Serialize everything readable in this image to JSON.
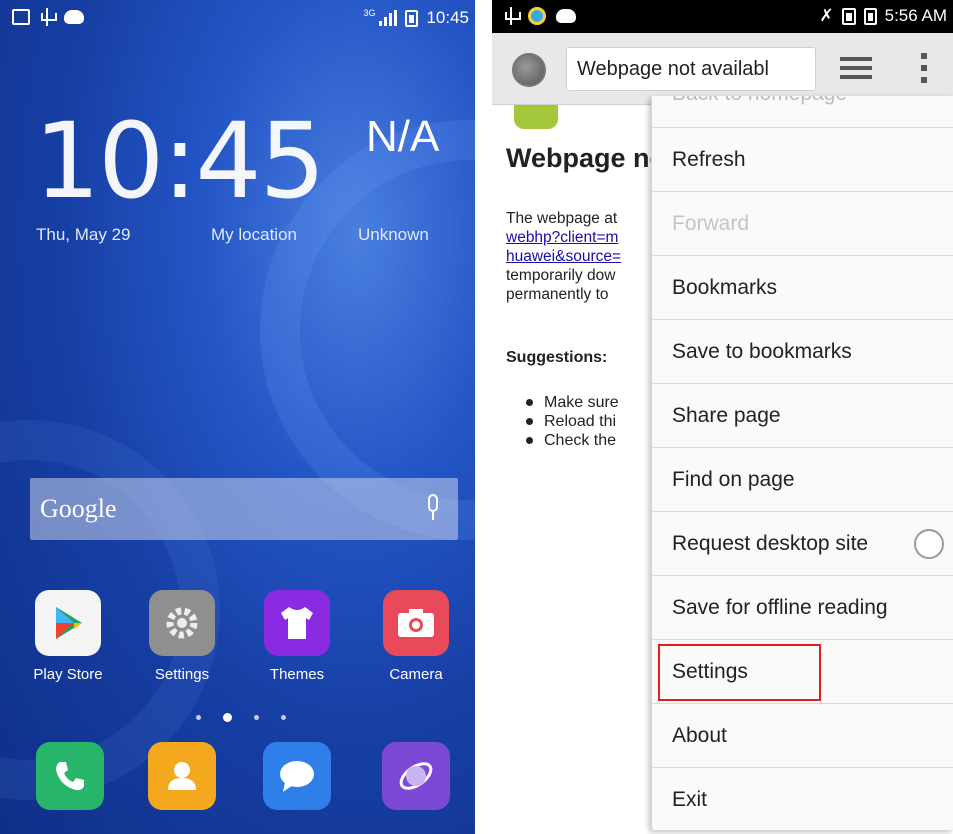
{
  "left_phone": {
    "status_bar": {
      "network_label": "3G",
      "time": "10:45"
    },
    "clock": {
      "hours": "10",
      "separator": ":",
      "minutes": "45"
    },
    "weather": {
      "temperature": "N/A",
      "date": "Thu, May 29",
      "location": "My location",
      "condition": "Unknown"
    },
    "search": {
      "placeholder": "Google"
    },
    "apps": [
      {
        "label": "Play Store",
        "icon": "play-store-icon"
      },
      {
        "label": "Settings",
        "icon": "settings-gear-icon"
      },
      {
        "label": "Themes",
        "icon": "themes-shirt-icon"
      },
      {
        "label": "Camera",
        "icon": "camera-icon"
      }
    ],
    "page_indicator": {
      "count": 4,
      "active": 2
    },
    "dock": [
      {
        "icon": "phone-icon"
      },
      {
        "icon": "contacts-icon"
      },
      {
        "icon": "messages-icon"
      },
      {
        "icon": "browser-icon"
      }
    ]
  },
  "right_phone": {
    "status_bar": {
      "time": "5:56 AM"
    },
    "toolbar": {
      "url_text": "Webpage not availabl"
    },
    "page": {
      "title": "Webpage not available",
      "body_line1": "The webpage at",
      "link_line1": "webhp?client=m",
      "link_line2": "huawei&source=",
      "body_line2": "temporarily dow",
      "body_line3": "permanently to",
      "suggestions_label": "Suggestions:",
      "suggestions": [
        "Make sure",
        "Reload thi",
        "Check the"
      ]
    },
    "menu": {
      "items": [
        {
          "label": "Back to homepage",
          "enabled": false
        },
        {
          "label": "Refresh",
          "enabled": true
        },
        {
          "label": "Forward",
          "enabled": false
        },
        {
          "label": "Bookmarks",
          "enabled": true
        },
        {
          "label": "Save to bookmarks",
          "enabled": true
        },
        {
          "label": "Share page",
          "enabled": true
        },
        {
          "label": "Find on page",
          "enabled": true
        },
        {
          "label": "Request desktop site",
          "enabled": true,
          "checked": false
        },
        {
          "label": "Save for offline reading",
          "enabled": true
        },
        {
          "label": "Settings",
          "enabled": true,
          "highlighted": true
        },
        {
          "label": "About",
          "enabled": true
        },
        {
          "label": "Exit",
          "enabled": true
        }
      ]
    }
  },
  "colors": {
    "highlight": "#e02020",
    "link": "#1a0dab",
    "android": "#a4c639"
  }
}
